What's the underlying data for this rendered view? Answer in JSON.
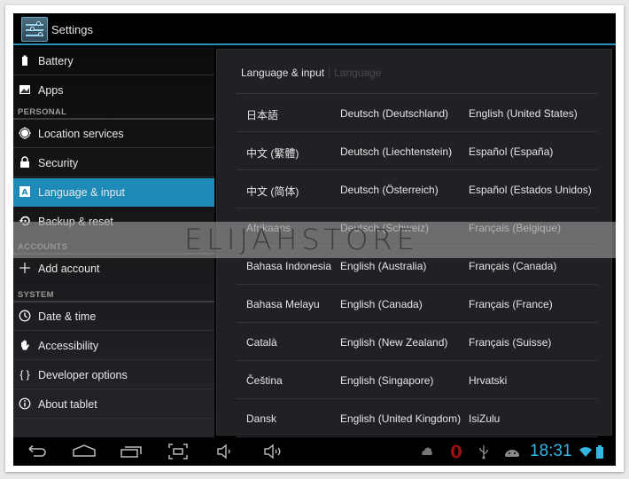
{
  "app": {
    "title": "Settings",
    "icon": "settings-sliders-icon"
  },
  "sidebar": {
    "items": [
      {
        "label": "Battery",
        "icon": "battery-icon"
      },
      {
        "label": "Apps",
        "icon": "apps-icon"
      },
      {
        "label": "Location services",
        "icon": "location-icon"
      },
      {
        "label": "Security",
        "icon": "lock-icon"
      },
      {
        "label": "Language & input",
        "icon": "language-icon",
        "selected": true
      },
      {
        "label": "Backup & reset",
        "icon": "backup-icon"
      },
      {
        "label": "Add account",
        "icon": "plus-icon"
      },
      {
        "label": "Date & time",
        "icon": "clock-icon"
      },
      {
        "label": "Accessibility",
        "icon": "hand-icon"
      },
      {
        "label": "Developer options",
        "icon": "braces-icon"
      },
      {
        "label": "About tablet",
        "icon": "info-icon"
      }
    ],
    "headers": {
      "personal": "PERSONAL",
      "accounts": "ACCOUNTS",
      "system": "SYSTEM"
    }
  },
  "main": {
    "breadcrumb": {
      "parent": "Language & input",
      "current": "Language"
    },
    "languages": [
      [
        "日本語",
        "Deutsch (Deutschland)",
        "English (United States)"
      ],
      [
        "中文 (繁體)",
        "Deutsch (Liechtenstein)",
        "Español (España)"
      ],
      [
        "中文 (简体)",
        "Deutsch (Österreich)",
        "Español (Estados Unidos)"
      ],
      [
        "Afrikaans",
        "Deutsch (Schweiz)",
        "Français (Belgique)"
      ],
      [
        "Bahasa Indonesia",
        "English (Australia)",
        "Français (Canada)"
      ],
      [
        "Bahasa Melayu",
        "English (Canada)",
        "Français (France)"
      ],
      [
        "Català",
        "English (New Zealand)",
        "Français (Suisse)"
      ],
      [
        "Čeština",
        "English (Singapore)",
        "Hrvatski"
      ],
      [
        "Dansk",
        "English (United Kingdom)",
        "IsiZulu"
      ]
    ]
  },
  "navbar": {
    "buttons": [
      "back-icon",
      "home-icon",
      "recent-apps-icon",
      "screenshot-icon",
      "volume-down-icon",
      "volume-up-icon"
    ],
    "status_icons": [
      "weather-icon",
      "opera-icon",
      "usb-icon",
      "android-debug-icon",
      "wifi-icon",
      "battery-icon"
    ],
    "time": "18:31"
  },
  "watermark": "ELIJAHSTORE",
  "colors": {
    "accent": "#33b5e5",
    "selected": "#1d8ab8"
  }
}
